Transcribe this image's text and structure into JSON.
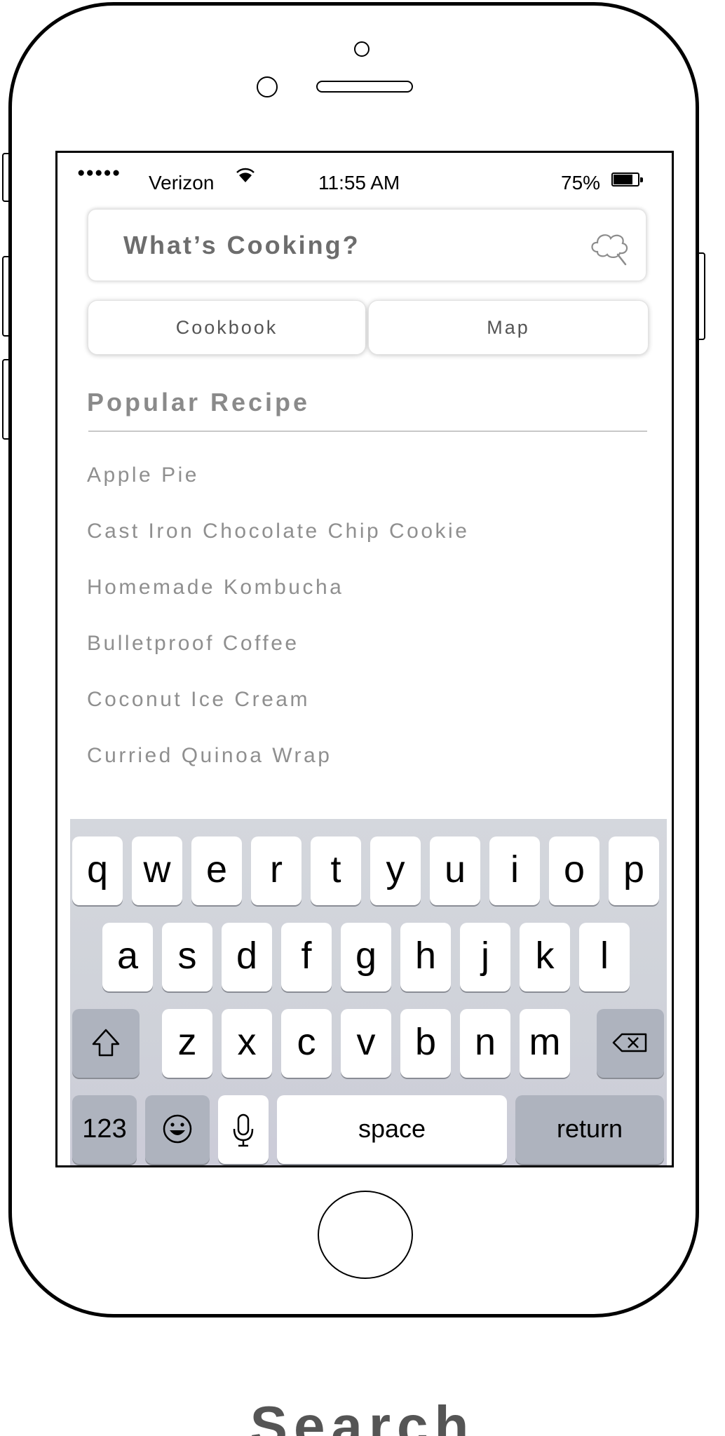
{
  "status_bar": {
    "signal": "●●●●●",
    "carrier": "Verizon",
    "time": "11:55 AM",
    "battery_percent": "75%",
    "battery_level": 0.75
  },
  "search": {
    "placeholder": "What’s Cooking?",
    "icon": "cloud-magnifier-icon"
  },
  "segments": {
    "cookbook_label": "Cookbook",
    "map_label": "Map"
  },
  "popular": {
    "title": "Popular Recipe",
    "items": [
      "Apple Pie",
      "Cast Iron Chocolate Chip Cookie",
      "Homemade Kombucha",
      "Bulletproof Coffee",
      "Coconut Ice Cream",
      "Curried Quinoa Wrap"
    ]
  },
  "keyboard": {
    "row1": [
      "q",
      "w",
      "e",
      "r",
      "t",
      "y",
      "u",
      "i",
      "o",
      "p"
    ],
    "row2": [
      "a",
      "s",
      "d",
      "f",
      "g",
      "h",
      "j",
      "k",
      "l"
    ],
    "row3": [
      "z",
      "x",
      "c",
      "v",
      "b",
      "n",
      "m"
    ],
    "numbers_label": "123",
    "space_label": "space",
    "return_label": "return",
    "icons": [
      "shift-icon",
      "backspace-icon",
      "emoji-icon",
      "microphone-icon"
    ]
  },
  "caption": "Search",
  "colors": {
    "muted_text": "#8f8f8f",
    "caption": "#555555",
    "keyboard_bg": "#d4d7dd",
    "dark_key": "#aeb3be"
  }
}
